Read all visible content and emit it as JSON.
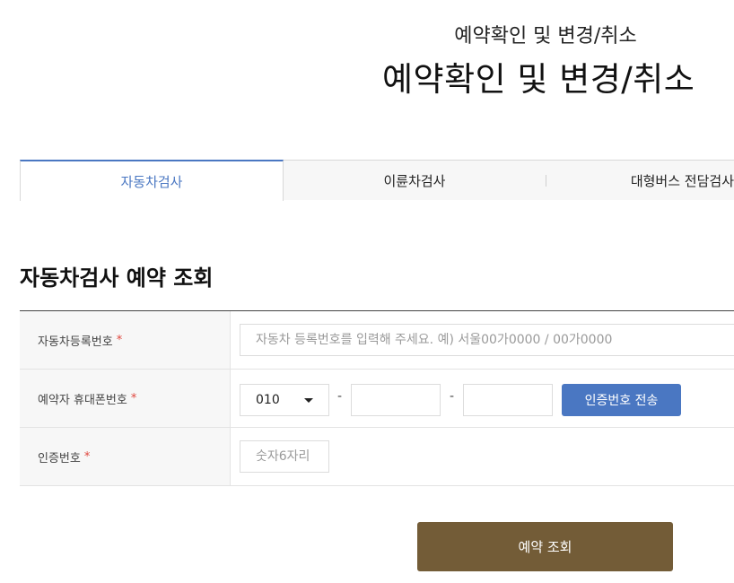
{
  "header": {
    "subtitle": "예약확인 및 변경/취소",
    "title": "예약확인 및 변경/취소"
  },
  "tabs": [
    {
      "label": "자동차검사",
      "active": true
    },
    {
      "label": "이륜차검사",
      "active": false
    },
    {
      "label": "대형버스 전담검사",
      "active": false
    }
  ],
  "section": {
    "title": "자동차검사 예약 조회"
  },
  "form": {
    "required_mark": "*",
    "reg_number": {
      "label": "자동차등록번호",
      "placeholder": "자동차 등록번호를 입력해 주세요. 예) 서울00가0000 / 00가0000",
      "value": ""
    },
    "phone": {
      "label": "예약자 휴대폰번호",
      "prefix_selected": "010",
      "separator": "-",
      "middle": "",
      "last": ""
    },
    "send_code_label": "인증번호 전송",
    "auth_code": {
      "label": "인증번호",
      "placeholder": "숫자6자리",
      "value": ""
    }
  },
  "submit_label": "예약 조회",
  "colors": {
    "tab_active": "#4a77c2",
    "send_button": "#4a77c2",
    "submit_button": "#735c37",
    "required_mark": "#e0463d"
  }
}
